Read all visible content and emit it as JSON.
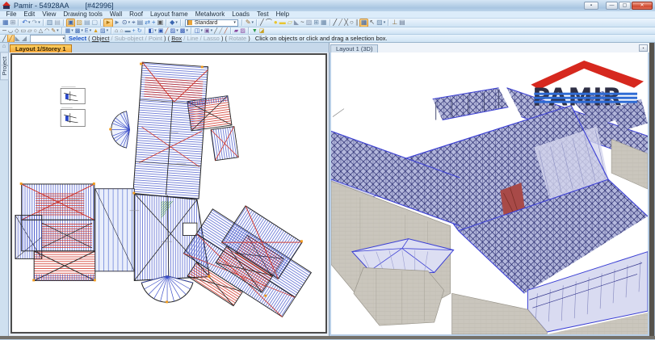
{
  "window": {
    "title": "Pamir - 54928AA",
    "doc_id": "[#42996]",
    "buttons": {
      "extra": "▪",
      "minimize": "—",
      "maximize": "▢",
      "close": "✕"
    }
  },
  "menu": {
    "items": [
      "File",
      "Edit",
      "View",
      "Drawing tools",
      "Wall",
      "Roof",
      "Layout frame",
      "Metalwork",
      "Loads",
      "Test",
      "Help"
    ]
  },
  "toolbar1": {
    "groups": [
      [
        {
          "n": "save",
          "g": "▦",
          "c": "#3a66b0"
        },
        {
          "n": "report",
          "g": "⊞",
          "c": "#7a8aa0"
        }
      ],
      [
        {
          "n": "undo",
          "g": "↶",
          "c": "#2a62c8",
          "caret": true
        },
        {
          "n": "redo",
          "g": "↷",
          "c": "#8aa0b8",
          "caret": true
        }
      ],
      [
        {
          "n": "window-split",
          "g": "▥",
          "c": "#6888aa"
        },
        {
          "n": "window-single",
          "g": "▤",
          "c": "#98a8ba"
        }
      ],
      [
        {
          "n": "plan-view",
          "g": "▣",
          "c": "#3a66b0",
          "sel": true
        },
        {
          "n": "image-view",
          "g": "▨",
          "c": "#c89a40"
        },
        {
          "n": "elevation-view",
          "g": "▤",
          "c": "#7a98b8"
        },
        {
          "n": "frame-view",
          "g": "▢",
          "c": "#7a98b8"
        }
      ],
      [
        {
          "n": "select-pointer",
          "g": "►",
          "c": "#b07a18",
          "sel": true
        },
        {
          "n": "select-add",
          "g": "►",
          "c": "#6a88a8"
        },
        {
          "n": "zoom",
          "g": "⊙",
          "c": "#3a5a90",
          "caret": true
        },
        {
          "n": "measure",
          "g": "⌖",
          "c": "#3a5a90"
        },
        {
          "n": "display",
          "g": "▤",
          "c": "#5a78a0"
        },
        {
          "n": "refresh",
          "g": "⇄",
          "c": "#3a78c8"
        },
        {
          "n": "pan",
          "g": "+",
          "c": "#3a78c8"
        },
        {
          "n": "camera",
          "g": "▣",
          "c": "#555555"
        }
      ],
      [
        {
          "n": "design-mode",
          "g": "◆",
          "c": "#3a66b0",
          "caret": true
        }
      ],
      [
        {
          "type": "combo",
          "n": "style-combo",
          "value": "Standard"
        }
      ],
      [
        {
          "n": "styles",
          "g": "✎",
          "c": "#9a6a2a",
          "caret": true
        }
      ],
      [
        {
          "n": "draw-line",
          "g": "╱",
          "c": "#444444"
        },
        {
          "n": "draw-arc",
          "g": "⌒",
          "c": "#444444"
        },
        {
          "n": "draw-circle",
          "g": "●",
          "c": "#e8c52e"
        },
        {
          "n": "draw-rect",
          "g": "▬",
          "c": "#e8c52e"
        },
        {
          "n": "draw-poly",
          "g": "▱",
          "c": "#c8b43a"
        },
        {
          "n": "draw-pitch",
          "g": "◣",
          "c": "#8898b0"
        },
        {
          "n": "draw-spline",
          "g": "~",
          "c": "#444444"
        },
        {
          "n": "draw-hatch",
          "g": "▨",
          "c": "#8898b0"
        },
        {
          "n": "copy",
          "g": "⊞",
          "c": "#6a88a8"
        },
        {
          "n": "group",
          "g": "▦",
          "c": "#6a88a8"
        }
      ],
      [
        {
          "n": "edit-line",
          "g": "╱",
          "c": "#333333"
        },
        {
          "n": "edit-pen",
          "g": "╱",
          "c": "#777777"
        },
        {
          "n": "trim",
          "g": "╳",
          "c": "#555555"
        },
        {
          "n": "ring",
          "g": "○",
          "c": "#555555"
        },
        {
          "n": "offset",
          "g": "∥",
          "c": "#888888"
        },
        {
          "n": "map",
          "g": "▦",
          "c": "#3a66b0",
          "sel": true
        },
        {
          "n": "pick",
          "g": "↖",
          "c": "#555555"
        },
        {
          "n": "fill",
          "g": "▨",
          "c": "#6a88a8",
          "caret": true
        }
      ],
      [
        {
          "n": "stamp",
          "g": "⊥",
          "c": "#8a6a3a"
        },
        {
          "n": "output",
          "g": "▤",
          "c": "#6a7a92"
        }
      ]
    ]
  },
  "toolbar2": {
    "groups": [
      [
        {
          "n": "seg-line",
          "g": "─",
          "c": "#333333"
        },
        {
          "n": "seg-arc",
          "g": "◡",
          "c": "#333333"
        },
        {
          "n": "node",
          "g": "◇",
          "c": "#555555"
        },
        {
          "n": "shape-rect",
          "g": "▭",
          "c": "#555555"
        },
        {
          "n": "shape-para",
          "g": "▱",
          "c": "#555555"
        },
        {
          "n": "shape-ellipse",
          "g": "○",
          "c": "#555555"
        },
        {
          "n": "shape-tri",
          "g": "△",
          "c": "#555555"
        },
        {
          "n": "shape-roof",
          "g": "◠",
          "c": "#555555"
        },
        {
          "n": "sketch",
          "g": "✎",
          "c": "#9a6a2a",
          "caret": true
        }
      ],
      [
        {
          "n": "wall-grid",
          "g": "▦",
          "c": "#3a66b0",
          "caret": true
        },
        {
          "n": "wall-panel",
          "g": "▩",
          "c": "#3a66b0",
          "caret": true
        },
        {
          "n": "wall-elevation",
          "g": "E",
          "c": "#3a66b0",
          "caret": true
        },
        {
          "n": "wall-gable",
          "g": "▲",
          "c": "#d8a020"
        },
        {
          "n": "wall-cut",
          "g": "▨",
          "c": "#3a66b0",
          "caret": true
        }
      ],
      [
        {
          "n": "roof-hip",
          "g": "⌂",
          "c": "#555555"
        },
        {
          "n": "roof-gable",
          "g": "⌂",
          "c": "#888888"
        },
        {
          "n": "roof-panel",
          "g": "▬",
          "c": "#6a88a8"
        },
        {
          "n": "roof-move",
          "g": "+",
          "c": "#3a78c8"
        },
        {
          "n": "roof-rotate",
          "g": "↻",
          "c": "#3a78c8"
        }
      ],
      [
        {
          "n": "truss-layout",
          "g": "◧",
          "c": "#2a52b0",
          "caret": true
        },
        {
          "n": "truss-area",
          "g": "▣",
          "c": "#2a52b0"
        },
        {
          "n": "truss-span",
          "g": "╱",
          "c": "#b04a2a"
        },
        {
          "n": "truss-infill",
          "g": "▨",
          "c": "#2a52b0",
          "caret": true
        },
        {
          "n": "truss-edit",
          "g": "▩",
          "c": "#2a52b0",
          "caret": true
        }
      ],
      [
        {
          "n": "frame-layout",
          "g": "◫",
          "c": "#2a52b0",
          "caret": true
        },
        {
          "n": "frame-edit",
          "g": "▣",
          "c": "#7a5a9a",
          "caret": true
        },
        {
          "n": "member-1",
          "g": "╱",
          "c": "#555555"
        },
        {
          "n": "member-2",
          "g": "╱",
          "c": "#888888"
        },
        {
          "n": "member-3",
          "g": "╱",
          "c": "#b04a2a"
        }
      ],
      [
        {
          "n": "metal-plate",
          "g": "▰",
          "c": "#8a4aa0"
        },
        {
          "n": "metal-edit",
          "g": "▨",
          "c": "#8a4aa0"
        }
      ],
      [
        {
          "n": "loads",
          "g": "▼",
          "c": "#2a9a4a"
        },
        {
          "n": "check",
          "g": "◪",
          "c": "#c8a020"
        }
      ]
    ]
  },
  "mode": {
    "icons": [
      {
        "n": "mode-line",
        "g": "╱",
        "c": "#555555"
      },
      {
        "n": "mode-select",
        "g": "╱",
        "c": "#b06a10",
        "sel": true
      },
      {
        "n": "mode-a",
        "g": "◣",
        "c": "#8899aa"
      },
      {
        "n": "mode-b",
        "g": "◢",
        "c": "#8899aa"
      }
    ]
  },
  "prompt": {
    "segments": [
      {
        "text": "Select",
        "cls": "cmd"
      },
      {
        "text": "  ( ",
        "cls": "dark"
      },
      {
        "text": "Object",
        "cls": "dark-u"
      },
      {
        "text": " / ",
        "cls": "muted"
      },
      {
        "text": "Sub-object",
        "cls": "muted"
      },
      {
        "text": " / ",
        "cls": "muted"
      },
      {
        "text": "Point",
        "cls": "muted"
      },
      {
        "text": " )  ( ",
        "cls": "dark"
      },
      {
        "text": "Box",
        "cls": "dark-u"
      },
      {
        "text": " / ",
        "cls": "muted"
      },
      {
        "text": "Line",
        "cls": "muted"
      },
      {
        "text": " / ",
        "cls": "muted"
      },
      {
        "text": "Lasso",
        "cls": "muted"
      },
      {
        "text": " )  ( ",
        "cls": "dark"
      },
      {
        "text": "Rotate",
        "cls": "muted"
      },
      {
        "text": " )",
        "cls": "dark"
      },
      {
        "text": "Click on objects or click and drag a selection box.",
        "cls": "help"
      }
    ]
  },
  "sidebar": {
    "project_tab": "Project",
    "home_icon": "⌂"
  },
  "panels": {
    "left_tab": "Layout 1/Storey 1",
    "right_tab": "Layout 1 (3D)",
    "right_tab_button": "▪"
  },
  "logo": {
    "text": "PAMIR"
  },
  "colors": {
    "selection_orange": "#f3a63a",
    "truss_blue": "#3b4ec9",
    "truss_red": "#cf2d22",
    "hatch_green": "#3f8f3f",
    "wall_gray": "#cac6bd",
    "web_navy": "#23266b",
    "roof_lavender": "#d9dbf1",
    "edge_blue": "#3b3fd4",
    "logo_red": "#d6281e",
    "logo_dark": "#2e2f45",
    "logo_blue": "#2e6bd4"
  }
}
